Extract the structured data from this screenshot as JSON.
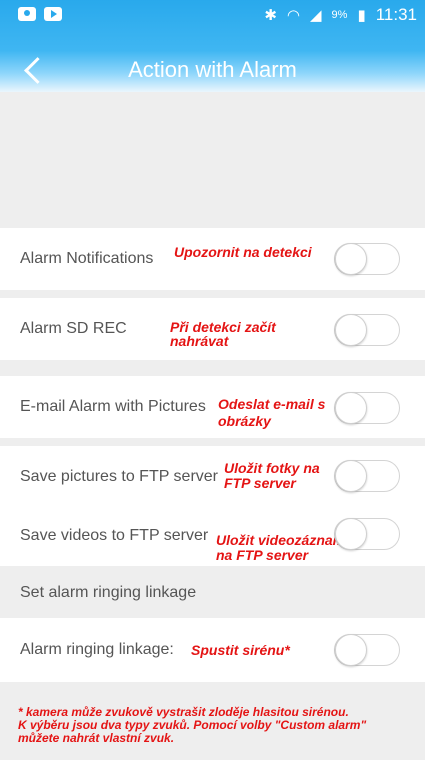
{
  "status_bar": {
    "battery": "9%",
    "time": "11:31"
  },
  "header": {
    "title": "Action with Alarm"
  },
  "rows": [
    {
      "label": "Alarm Notifications",
      "note": "Upozornit na detekci",
      "enabled": false
    },
    {
      "label": "Alarm SD REC",
      "note_line1": "Při detekci začít",
      "note_line2": "nahrávat",
      "enabled": false
    },
    {
      "label": "E-mail Alarm with Pictures",
      "note_line1": "Odeslat e-mail s",
      "note_line2": "obrázky",
      "enabled": false
    },
    {
      "label": "Save pictures to FTP server",
      "note_line1": "Uložit fotky na",
      "note_line2": "FTP server",
      "enabled": false
    },
    {
      "label": "Save videos to FTP server",
      "note_line1": "Uložit videozáznamy",
      "note_line2": "na FTP server",
      "enabled": false
    }
  ],
  "section": {
    "title": "Set alarm ringing linkage"
  },
  "ringing_row": {
    "label": "Alarm ringing linkage:",
    "note": "Spustit sirénu*",
    "enabled": false
  },
  "footnote": {
    "line1": "* kamera může zvukově vystrašit zloděje hlasitou sirénou.",
    "line2": "K výběru jsou dva typy zvuků. Pomocí volby \"Custom alarm\"",
    "line3": "můžete nahrát vlastní zvuk."
  }
}
